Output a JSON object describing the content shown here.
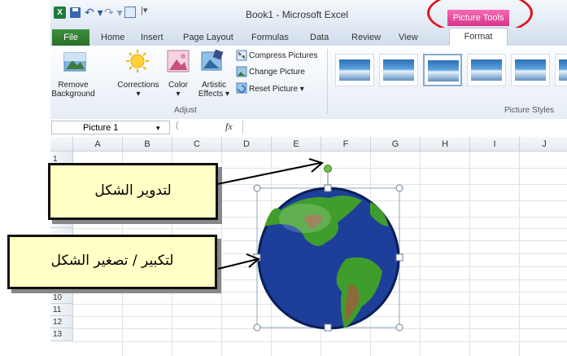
{
  "title_bar": {
    "app_logo": "X",
    "window_title": "Book1 - Microsoft Excel",
    "contextual_tab_group": "Picture Tools",
    "icons": [
      "excel-logo-icon",
      "save-icon",
      "undo-icon",
      "redo-icon",
      "print-preview-icon",
      "customize-toolbar-icon"
    ]
  },
  "tabs": {
    "file": "File",
    "items": [
      "Home",
      "Insert",
      "Page Layout",
      "Formulas",
      "Data",
      "Review",
      "View"
    ],
    "format": "Format"
  },
  "ribbon": {
    "remove_background": "Remove Background",
    "corrections": "Corrections",
    "color": "Color",
    "artistic_effects": "Artistic Effects",
    "compress_pictures": "Compress Pictures",
    "change_picture": "Change Picture",
    "reset_picture": "Reset Picture",
    "adjust_group": "Adjust",
    "picture_styles_group": "Picture Styles"
  },
  "formula_bar": {
    "name_box": "Picture 1",
    "fx": "fx"
  },
  "grid": {
    "columns": [
      "A",
      "B",
      "C",
      "D",
      "E",
      "F",
      "G",
      "H",
      "I",
      "J"
    ],
    "rows": [
      "1",
      "",
      "",
      "",
      "5",
      "",
      "",
      "",
      "",
      "10",
      "11",
      "12",
      "13"
    ]
  },
  "callouts": {
    "rotate_label": "لتدوير الشكل",
    "resize_label": "لتكبير / تصغير الشكل"
  },
  "colors": {
    "file_tab": "#2a6f2a",
    "picture_tools": "#d8338a",
    "highlight_oval": "#e1141d",
    "callout_fill": "#ffffc6",
    "rotation_handle": "#6cc04a"
  }
}
